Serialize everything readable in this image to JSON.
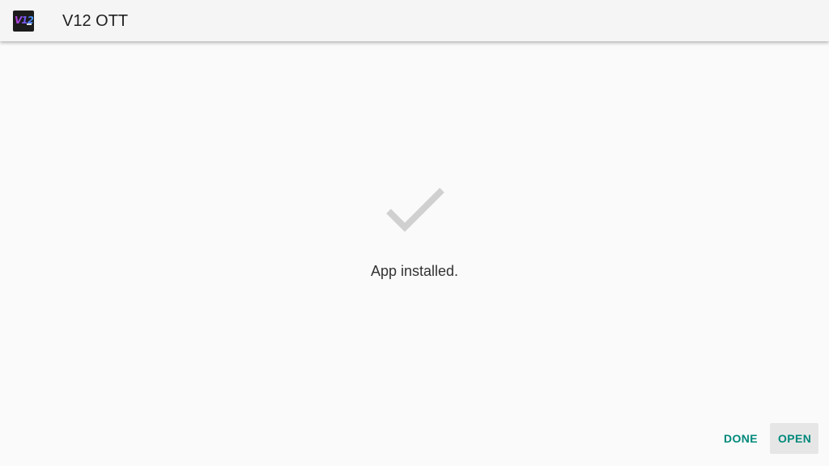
{
  "app": {
    "title": "V12 OTT",
    "icon_text": "V12",
    "icon": "app-logo-icon"
  },
  "status": {
    "icon": "checkmark-icon",
    "message": "App installed."
  },
  "actions": {
    "done_label": "DONE",
    "open_label": "OPEN"
  },
  "colors": {
    "accent": "#00897b",
    "check": "#d0d0d0",
    "background": "#fafafa",
    "app_bar": "#f5f5f5"
  }
}
